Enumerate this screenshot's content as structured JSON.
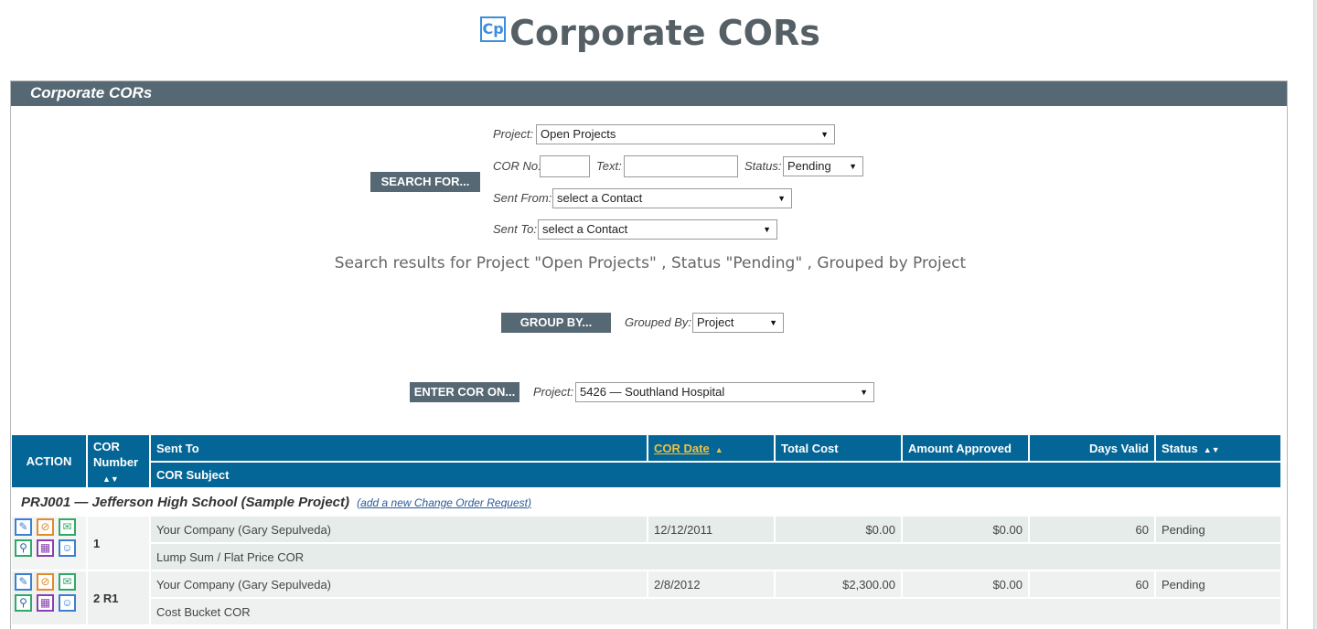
{
  "page": {
    "logo_text": "Cp",
    "title": "Corporate CORs"
  },
  "panel": {
    "header": "Corporate CORs"
  },
  "search": {
    "button_label": "SEARCH FOR...",
    "project_label": "Project:",
    "project_value": "Open Projects",
    "cor_no_label": "COR No:",
    "text_label": "Text:",
    "status_label": "Status:",
    "status_value": "Pending",
    "sent_from_label": "Sent From:",
    "sent_from_value": "select a Contact",
    "sent_to_label": "Sent To:",
    "sent_to_value": "select a Contact",
    "results_text": "Search results for Project \"Open Projects\" , Status  \"Pending\" , Grouped by Project"
  },
  "group": {
    "button_label": "GROUP BY...",
    "grouped_by_label": "Grouped By:",
    "grouped_by_value": "Project"
  },
  "enter": {
    "button_label": "ENTER COR ON...",
    "project_label": "Project:",
    "project_value": "5426 — Southland Hospital"
  },
  "table": {
    "headers": {
      "action": "ACTION",
      "cor_number": "COR Number",
      "sent_to": "Sent To",
      "cor_date": "COR Date",
      "total_cost": "Total Cost",
      "amount_approved": "Amount Approved",
      "days_valid": "Days Valid",
      "status": "Status",
      "cor_subject": "COR Subject"
    },
    "group": {
      "name": "PRJ001 — Jefferson High School (Sample Project)",
      "add_link": "(add a new Change Order Request)"
    },
    "rows": [
      {
        "cor_number": "1",
        "sent_to": "Your Company (Gary Sepulveda)",
        "cor_date": "12/12/2011",
        "total_cost": "$0.00",
        "amount_approved": "$0.00",
        "days_valid": "60",
        "status": "Pending",
        "subject": "Lump Sum / Flat Price COR"
      },
      {
        "cor_number": "2 R1",
        "sent_to": "Your Company (Gary Sepulveda)",
        "cor_date": "2/8/2012",
        "total_cost": "$2,300.00",
        "amount_approved": "$0.00",
        "days_valid": "60",
        "status": "Pending",
        "subject": "Cost Bucket COR"
      }
    ]
  },
  "colors": {
    "panel_header": "#566873",
    "table_header": "#046697",
    "sort_link": "#f0c040"
  }
}
